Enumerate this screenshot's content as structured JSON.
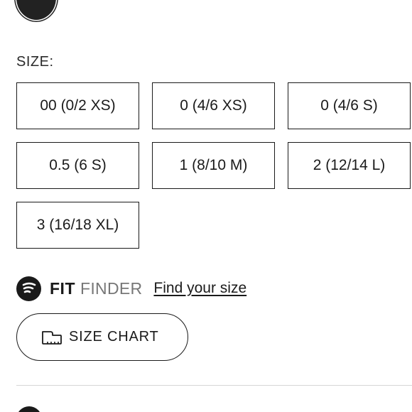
{
  "size_section": {
    "label": "SIZE:",
    "options": [
      "00 (0/2 XS)",
      "0 (4/6 XS)",
      "0 (4/6 S)",
      "0.5 (6 S)",
      "1 (8/10 M)",
      "2 (12/14 L)",
      "3 (16/18 XL)"
    ]
  },
  "fit_finder": {
    "brand_bold": "FIT",
    "brand_light": "FINDER",
    "link": "Find your size",
    "logo_icon": "fit-finder-logo-icon"
  },
  "size_chart": {
    "label": "SIZE CHART",
    "icon": "ruler-icon"
  },
  "colors": {
    "text": "#1a1a1a",
    "muted": "#777777",
    "divider": "#d6d6d6"
  }
}
